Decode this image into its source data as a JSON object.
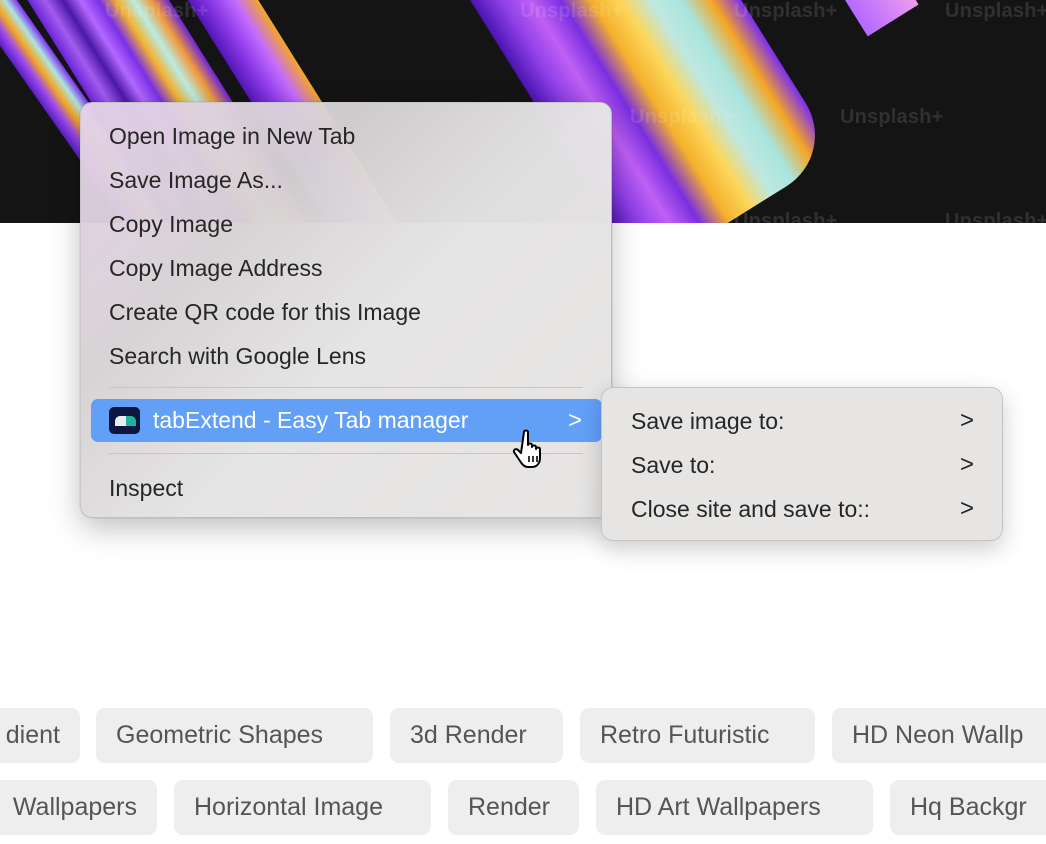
{
  "hero_image": {
    "watermark_text": "Unsplash+",
    "colors": {
      "background": "#141414",
      "purple": "#7b2ff0",
      "violet": "#a04ce8",
      "orange": "#f5a623",
      "cyan": "#aee4e0"
    }
  },
  "context_menu": {
    "items": [
      {
        "label": "Open Image in New Tab"
      },
      {
        "label": "Save Image As..."
      },
      {
        "label": "Copy Image"
      },
      {
        "label": "Copy Image Address"
      },
      {
        "label": "Create QR code for this Image"
      },
      {
        "label": "Search with Google Lens"
      }
    ],
    "extension_item": {
      "label": "tabExtend - Easy Tab manager",
      "icon": "tabextend-logo-icon",
      "submenu_indicator": ">",
      "highlighted": true,
      "highlight_color": "#62a0f8"
    },
    "inspect_label": "Inspect"
  },
  "submenu": {
    "items": [
      {
        "label": "Save image to:",
        "indicator": ">"
      },
      {
        "label": "Save to:",
        "indicator": ">"
      },
      {
        "label": "Close site and save to::",
        "indicator": ">"
      }
    ]
  },
  "tags": {
    "row1": [
      "Gradient",
      "Geometric Shapes",
      "3d Render",
      "Retro Futuristic",
      "HD Neon Wallpapers"
    ],
    "row1_visible": [
      "dient",
      "Geometric Shapes",
      "3d Render",
      "Retro Futuristic",
      "HD Neon Wallp"
    ],
    "row2": [
      "Wallpapers",
      "Horizontal Image",
      "Render",
      "HD Art Wallpapers",
      "Hq Background"
    ],
    "row2_visible": [
      "Wallpapers",
      "Horizontal Image",
      "Render",
      "HD Art Wallpapers",
      "Hq Backgr"
    ]
  }
}
